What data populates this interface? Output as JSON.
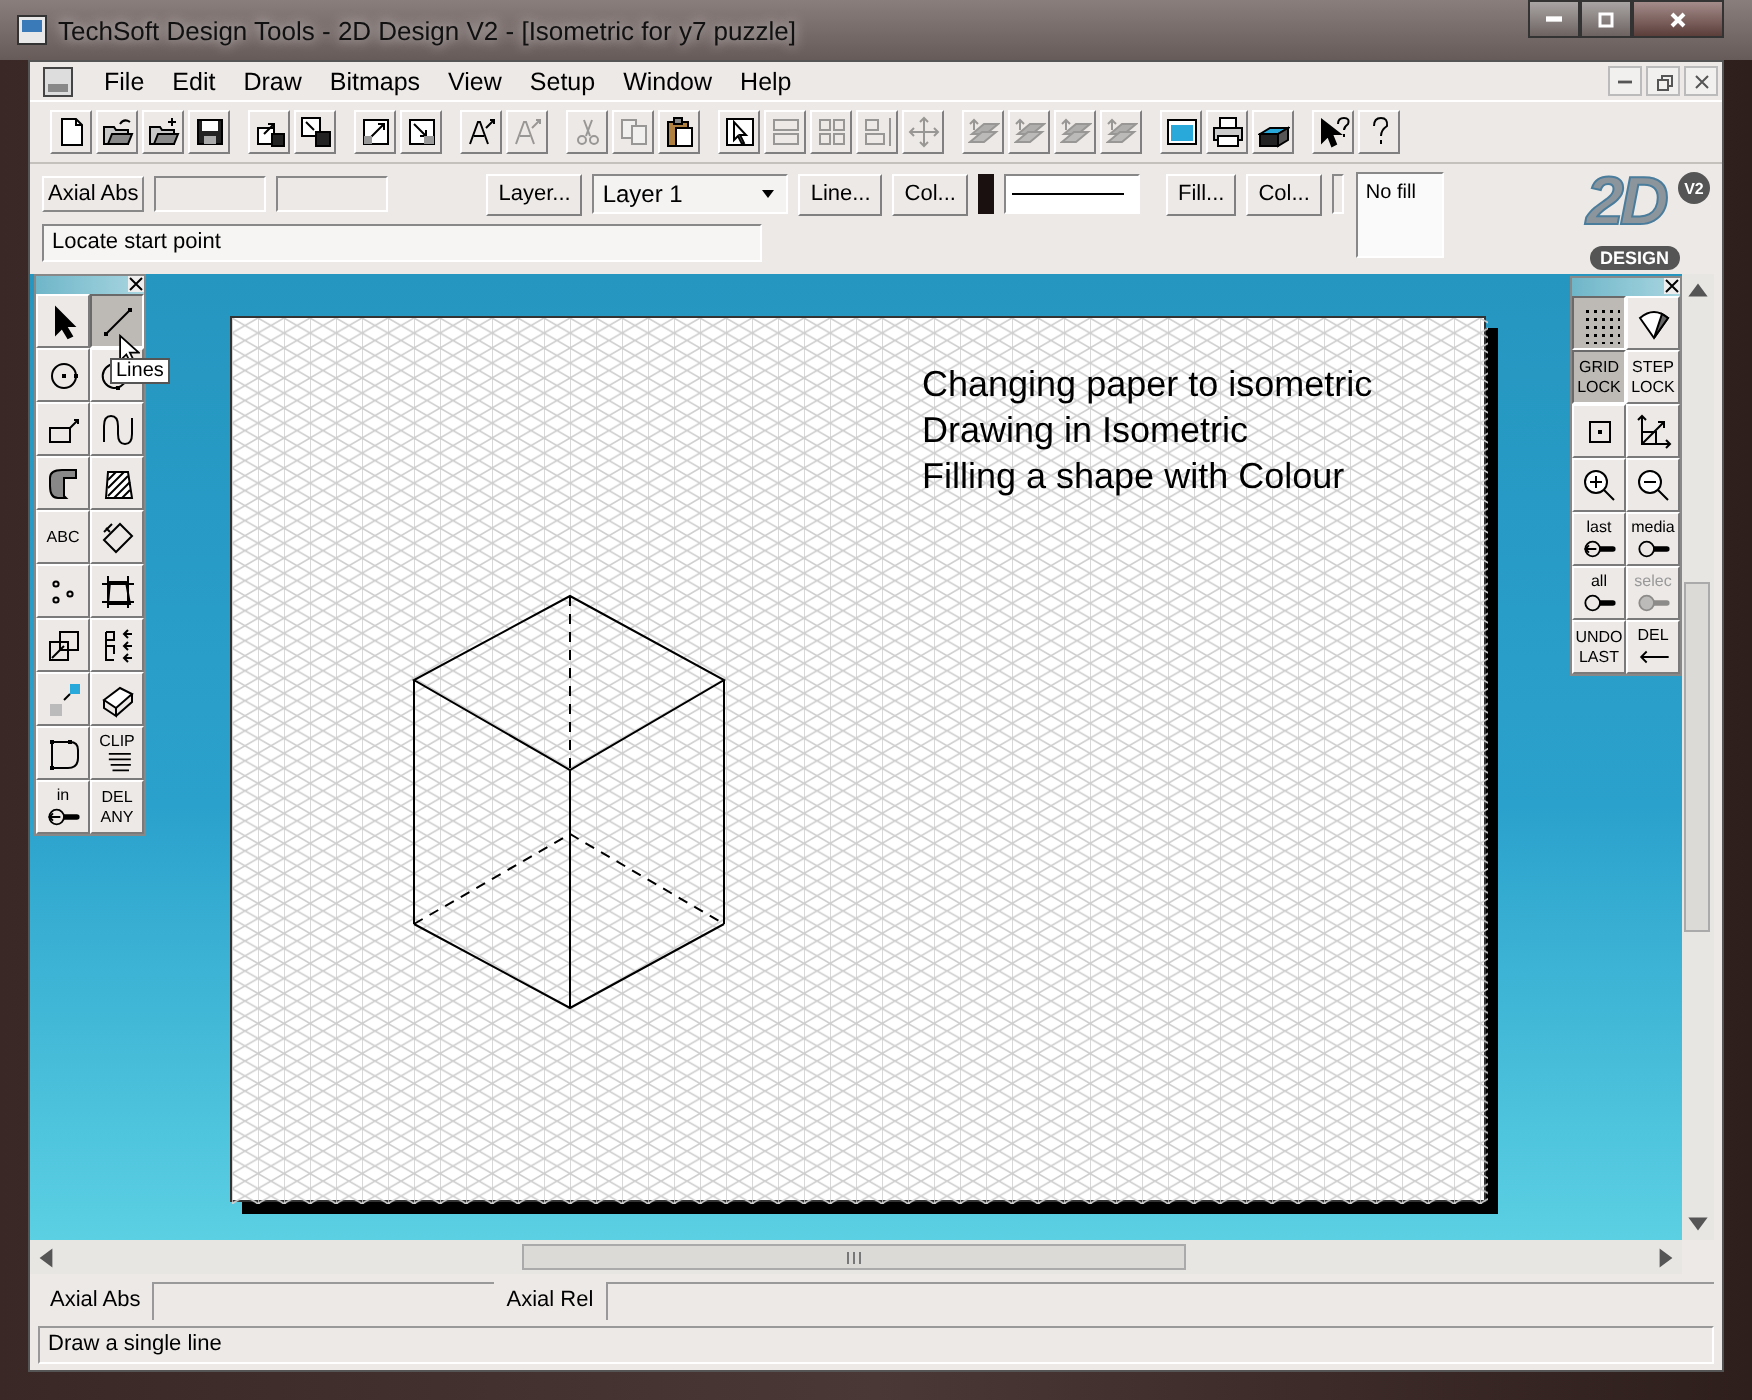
{
  "window": {
    "title": "TechSoft Design Tools - 2D Design V2 - [Isometric for y7 puzzle]"
  },
  "menu": [
    "File",
    "Edit",
    "Draw",
    "Bitmaps",
    "View",
    "Setup",
    "Window",
    "Help"
  ],
  "toolbar": [
    [
      {
        "kind": "new",
        "disabled": false
      },
      {
        "kind": "open",
        "disabled": false
      },
      {
        "kind": "open-add",
        "disabled": false
      },
      {
        "kind": "save",
        "disabled": false
      }
    ],
    [
      {
        "kind": "export-part",
        "disabled": false
      },
      {
        "kind": "import-part",
        "disabled": false
      }
    ],
    [
      {
        "kind": "zoom-window",
        "disabled": false
      },
      {
        "kind": "zoom-fit",
        "disabled": false
      }
    ],
    [
      {
        "kind": "text",
        "disabled": false
      },
      {
        "kind": "text",
        "disabled": true
      }
    ],
    [
      {
        "kind": "cut",
        "disabled": true
      },
      {
        "kind": "copy",
        "disabled": true
      },
      {
        "kind": "paste",
        "disabled": false
      }
    ],
    [
      {
        "kind": "select-box",
        "disabled": false
      },
      {
        "kind": "group",
        "disabled": true
      },
      {
        "kind": "ungroup",
        "disabled": true
      },
      {
        "kind": "align",
        "disabled": true
      },
      {
        "kind": "move",
        "disabled": true
      }
    ],
    [
      {
        "kind": "layer",
        "disabled": true
      },
      {
        "kind": "layer",
        "disabled": true
      },
      {
        "kind": "layer",
        "disabled": true
      },
      {
        "kind": "layer",
        "disabled": true
      }
    ],
    [
      {
        "kind": "screen",
        "disabled": false
      },
      {
        "kind": "print",
        "disabled": false
      },
      {
        "kind": "export-3d",
        "disabled": false
      }
    ],
    [
      {
        "kind": "context-help",
        "disabled": false
      },
      {
        "kind": "help",
        "disabled": false
      }
    ]
  ],
  "options": {
    "axial_label": "Axial Abs",
    "layer_button": "Layer...",
    "layer_select": "Layer 1",
    "line_button": "Line...",
    "line_color_button": "Col...",
    "fill_button": "Fill...",
    "fill_color_button": "Col...",
    "fill_preview": "No fill",
    "prompt": "Locate start point"
  },
  "logo": {
    "text": "2D",
    "version": "V2",
    "badge": "DESIGN"
  },
  "left_tools": [
    {
      "kind": "pointer",
      "selected": false,
      "disabled": false
    },
    {
      "kind": "line",
      "selected": true,
      "disabled": false
    },
    {
      "kind": "circle",
      "selected": false,
      "disabled": false
    },
    {
      "kind": "arc",
      "selected": false,
      "disabled": false
    },
    {
      "kind": "rect",
      "selected": false,
      "disabled": false
    },
    {
      "kind": "curve",
      "selected": false,
      "disabled": false
    },
    {
      "kind": "hook",
      "selected": false,
      "disabled": false
    },
    {
      "kind": "hatch",
      "selected": false,
      "disabled": false
    },
    {
      "kind": "text",
      "label": "ABC",
      "selected": false,
      "disabled": false
    },
    {
      "kind": "dimension",
      "selected": false,
      "disabled": false
    },
    {
      "kind": "points",
      "selected": false,
      "disabled": false
    },
    {
      "kind": "trim",
      "selected": false,
      "disabled": false
    },
    {
      "kind": "squares",
      "selected": false,
      "disabled": false
    },
    {
      "kind": "align-left",
      "selected": false,
      "disabled": false
    },
    {
      "kind": "scale",
      "selected": false,
      "disabled": false
    },
    {
      "kind": "box3d",
      "selected": false,
      "disabled": false
    },
    {
      "kind": "polygon",
      "selected": false,
      "disabled": false
    },
    {
      "kind": "clip",
      "label": "CLIP",
      "selected": false,
      "disabled": false
    },
    {
      "kind": "zoom-arrow",
      "label": "in",
      "selected": false,
      "disabled": false
    },
    {
      "kind": "text",
      "label": "DEL ANY",
      "selected": false,
      "disabled": false
    }
  ],
  "tooltip": "Lines",
  "right_tools": [
    {
      "kind": "grid",
      "selected": true,
      "disabled": false
    },
    {
      "kind": "fan",
      "selected": false,
      "disabled": false
    },
    {
      "kind": "text",
      "label": "GRID LOCK",
      "selected": true,
      "disabled": false
    },
    {
      "kind": "text",
      "label": "STEP LOCK",
      "selected": false,
      "disabled": false
    },
    {
      "kind": "square-dot",
      "selected": false,
      "disabled": false
    },
    {
      "kind": "axes",
      "selected": false,
      "disabled": false
    },
    {
      "kind": "zoom-in",
      "selected": false,
      "disabled": false
    },
    {
      "kind": "zoom-out",
      "selected": false,
      "disabled": false
    },
    {
      "kind": "zoom-arrow",
      "label": "last",
      "selected": false,
      "disabled": false
    },
    {
      "kind": "zoom-plain",
      "label": "media",
      "selected": false,
      "disabled": false
    },
    {
      "kind": "zoom-plain",
      "label": "all",
      "selected": false,
      "disabled": false
    },
    {
      "kind": "zoom-filled",
      "label": "selec",
      "selected": false,
      "disabled": true
    },
    {
      "kind": "text",
      "label": "UNDO LAST",
      "selected": false,
      "disabled": false
    },
    {
      "kind": "delete-arrow",
      "label": "DEL",
      "selected": false,
      "disabled": false
    }
  ],
  "paper": {
    "notes": [
      "Changing paper to isometric",
      "Drawing in Isometric",
      "Filling a shape with Colour"
    ]
  },
  "status": {
    "axial_abs": "Axial Abs",
    "axial_rel": "Axial Rel",
    "hint": "Draw a single line"
  }
}
